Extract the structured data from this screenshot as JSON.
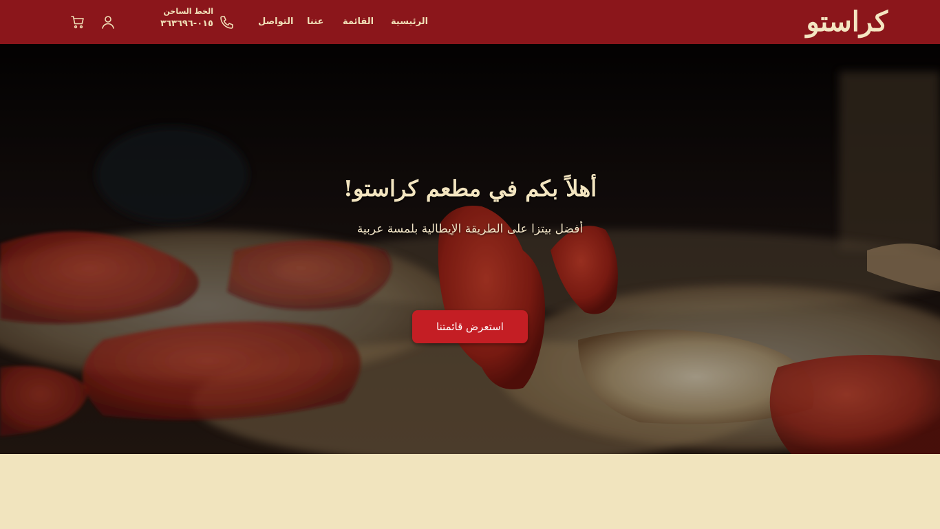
{
  "header": {
    "logo_text": "كراستو",
    "nav": {
      "home": "الرئيسية",
      "menu": "القائمة",
      "about": "عننا",
      "contact": "التواصل"
    },
    "hotline_label": "الخط الساخن",
    "hotline_number": "٠١٥-٣٦٣٦٩٦",
    "icons": [
      "phone-icon",
      "user-icon",
      "cart-icon"
    ]
  },
  "hero": {
    "title": "أهلاً بكم في مطعم كراستو!",
    "subtitle": "أفضل بيتزا على الطريقة الإيطالية بلمسة عربية",
    "cta_label": "استعرض قائمتنا"
  },
  "colors": {
    "header_bg": "#8b161b",
    "header_text": "#f1e0b8",
    "cta_bg": "#c41e24",
    "page_bg": "#f1e4be"
  }
}
